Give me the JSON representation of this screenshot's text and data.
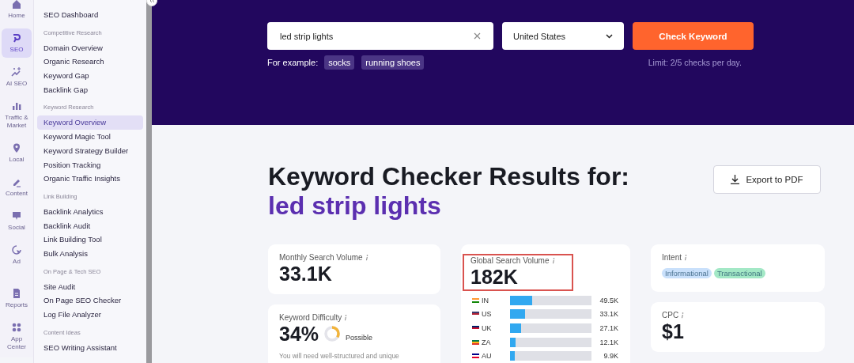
{
  "rail": [
    {
      "label": "Home",
      "selected": false
    },
    {
      "label": "SEO",
      "selected": true
    },
    {
      "label": "AI SEO",
      "selected": false
    },
    {
      "label": "Traffic & Market",
      "selected": false
    },
    {
      "label": "Local",
      "selected": false
    },
    {
      "label": "Content",
      "selected": false
    },
    {
      "label": "Social",
      "selected": false
    },
    {
      "label": "Ad",
      "selected": false
    },
    {
      "label": "Reports",
      "selected": false
    },
    {
      "label": "App Center",
      "selected": false
    }
  ],
  "menu": [
    {
      "items": [
        {
          "label": "SEO Dashboard",
          "selected": false
        }
      ]
    },
    {
      "heading": "Competitive Research",
      "items": [
        {
          "label": "Domain Overview",
          "selected": false
        },
        {
          "label": "Organic Research",
          "selected": false
        },
        {
          "label": "Keyword Gap",
          "selected": false
        },
        {
          "label": "Backlink Gap",
          "selected": false
        }
      ]
    },
    {
      "heading": "Keyword Research",
      "items": [
        {
          "label": "Keyword Overview",
          "selected": true
        },
        {
          "label": "Keyword Magic Tool",
          "selected": false
        },
        {
          "label": "Keyword Strategy Builder",
          "selected": false
        },
        {
          "label": "Position Tracking",
          "selected": false
        },
        {
          "label": "Organic Traffic Insights",
          "selected": false
        }
      ]
    },
    {
      "heading": "Link Building",
      "items": [
        {
          "label": "Backlink Analytics",
          "selected": false
        },
        {
          "label": "Backlink Audit",
          "selected": false
        },
        {
          "label": "Link Building Tool",
          "selected": false
        },
        {
          "label": "Bulk Analysis",
          "selected": false
        }
      ]
    },
    {
      "heading": "On Page & Tech SEO",
      "items": [
        {
          "label": "Site Audit",
          "selected": false
        },
        {
          "label": "On Page SEO Checker",
          "selected": false
        },
        {
          "label": "Log File Analyzer",
          "selected": false
        }
      ]
    },
    {
      "heading": "Content Ideas",
      "items": [
        {
          "label": "SEO Writing Assistant",
          "selected": false
        }
      ]
    }
  ],
  "search": {
    "value": "led strip lights",
    "country": "United States",
    "button": "Check Keyword",
    "examples_label": "For example:",
    "examples": [
      "socks",
      "running shoes"
    ],
    "limit": "Limit: 2/5 checks per day."
  },
  "results": {
    "title": "Keyword Checker Results for:",
    "keyword": "led strip lights",
    "export": "Export to PDF",
    "monthly": {
      "label": "Monthly Search Volume",
      "value": "33.1K"
    },
    "global": {
      "label": "Global Search Volume",
      "value": "182K",
      "countries": [
        {
          "code": "IN",
          "value": "49.5K",
          "level": 0.27
        },
        {
          "code": "US",
          "value": "33.1K",
          "level": 0.18
        },
        {
          "code": "UK",
          "value": "27.1K",
          "level": 0.14
        },
        {
          "code": "ZA",
          "value": "12.1K",
          "level": 0.07
        },
        {
          "code": "AU",
          "value": "9.9K",
          "level": 0.055
        }
      ]
    },
    "difficulty": {
      "label": "Keyword Difficulty",
      "value": "34%",
      "level": 0.34,
      "rating": "Possible",
      "description": "You will need well-structured and unique"
    },
    "intent": {
      "label": "Intent",
      "tags": [
        {
          "label": "Informational",
          "color": "#c9e0fb"
        },
        {
          "label": "Transactional",
          "color": "#a3e8c6"
        }
      ]
    },
    "cpc": {
      "label": "CPC",
      "value": "$1"
    }
  }
}
